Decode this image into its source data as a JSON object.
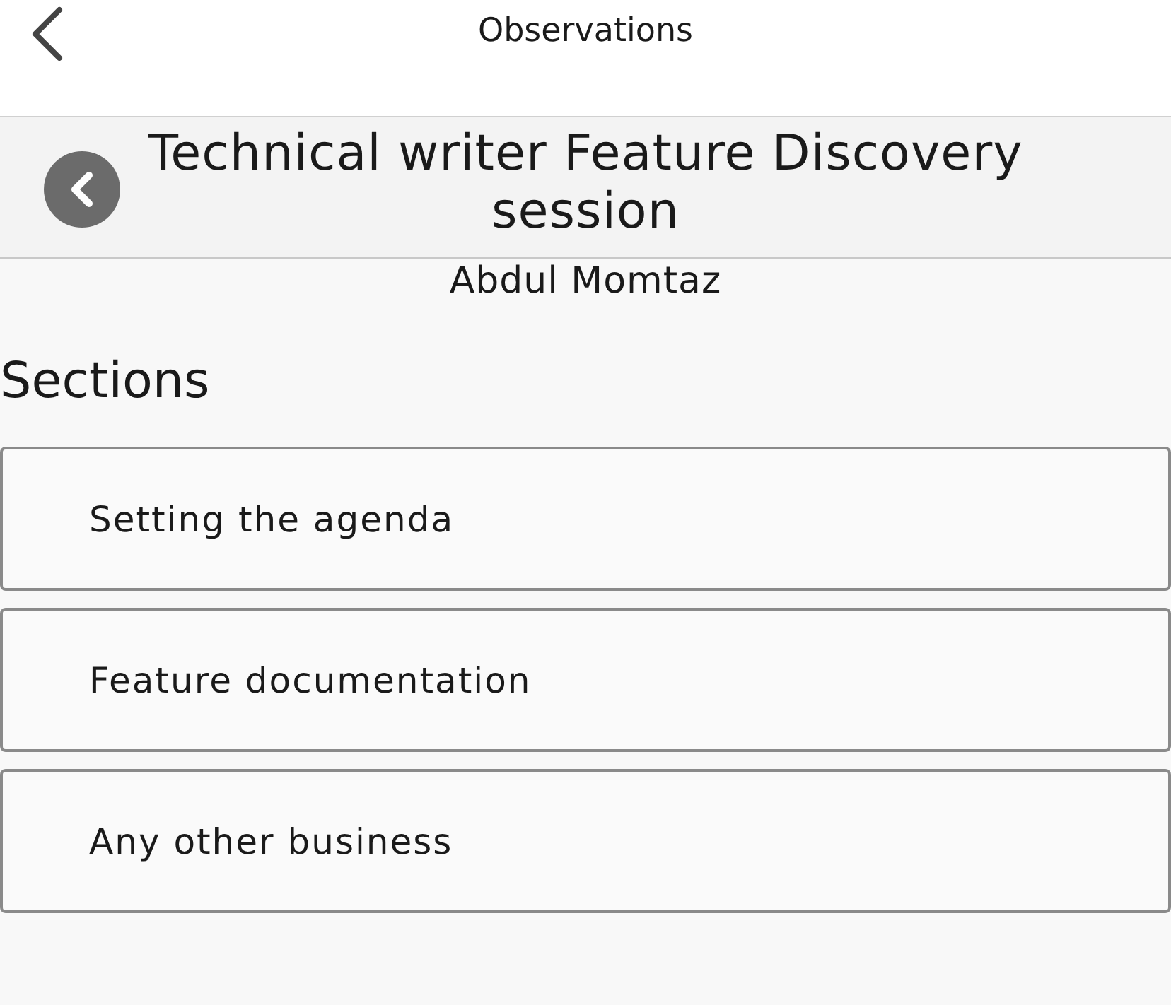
{
  "header": {
    "title": "Observations"
  },
  "session": {
    "title": "Technical writer Feature Discovery session",
    "author": "Abdul Momtaz"
  },
  "sections_heading": "Sections",
  "sections": [
    {
      "label": "Setting the agenda"
    },
    {
      "label": "Feature documentation"
    },
    {
      "label": "Any other business"
    }
  ]
}
